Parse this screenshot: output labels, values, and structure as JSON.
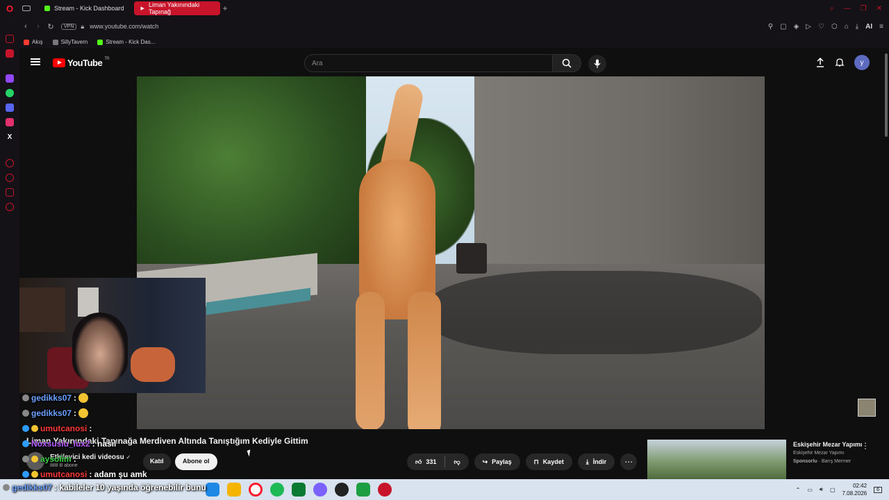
{
  "browser": {
    "tabs": [
      {
        "label": "Stream - Kick Dashboard",
        "color": "#53fc18"
      },
      {
        "label": "Liman Yakınındaki Tapınağ",
        "color": "#ffffff"
      }
    ],
    "new_tab": "+",
    "vpn": "VPN",
    "url": "www.youtube.com/watch",
    "ai": "AI",
    "bookmarks": [
      {
        "label": "Akış",
        "color": "#ff3b30"
      },
      {
        "label": "SillyTavern",
        "color": "#777777"
      },
      {
        "label": "Stream - Kick Das...",
        "color": "#53fc18"
      }
    ]
  },
  "youtube": {
    "logo_text": "YouTube",
    "region": "TR",
    "search_placeholder": "Ara",
    "avatar_letter": "y",
    "video_title": "Liman Yakınındaki Tapınağa Merdiven Altında Tanıştığım Kediyle Gittim",
    "channel_name": "Etkileyici kedi videosu",
    "channel_subs": "888 B abone",
    "join_label": "Katıl",
    "subscribe_label": "Abone ol",
    "like_count": "331",
    "share_label": "Paylaş",
    "save_label": "Kaydet",
    "download_label": "İndir",
    "ad": {
      "title": "Eskişehir Mezar Yapımı",
      "subtitle": "Eskişehir Mezar Yapımı",
      "sponsored": "Sponsorlu",
      "advertiser": "Barış Mermer"
    }
  },
  "chat": [
    {
      "user": "gedikks07",
      "text": ":",
      "color": "#6aa0ff"
    },
    {
      "user": "gedikks07",
      "text": ":",
      "color": "#6aa0ff"
    },
    {
      "user": "umutcanosi",
      "text": ":",
      "color": "#ff3a3a"
    },
    {
      "user": "Noxsusiu_lux2",
      "text": ": nasıl",
      "color": "#b85cff"
    },
    {
      "user": "aysolim",
      "text": ":",
      "color": "#3fd14a"
    },
    {
      "user": "umutcanosi",
      "text": ": adam şu amk",
      "color": "#ff3a3a"
    },
    {
      "user": "gedikks07",
      "text": ": kabileler 10 yaşında öğrenebilir bunu",
      "color": "#6aa0ff"
    }
  ],
  "taskbar": {
    "time": "02:42",
    "date": "7.08.2026",
    "notifications": "6"
  }
}
